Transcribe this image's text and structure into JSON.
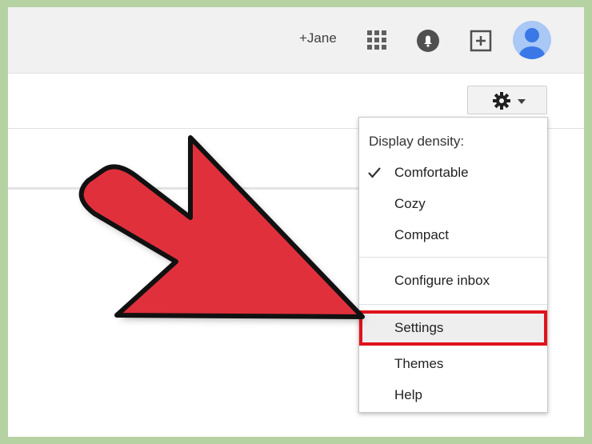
{
  "header": {
    "user_link": "+Jane",
    "icons": [
      "apps-grid-icon",
      "notifications-bell-icon",
      "share-plus-icon",
      "user-avatar-icon"
    ]
  },
  "toolbar": {
    "settings_icon": "gear-icon"
  },
  "menu": {
    "heading": "Display density:",
    "items": [
      {
        "label": "Comfortable",
        "checked": true
      },
      {
        "label": "Cozy",
        "checked": false
      },
      {
        "label": "Compact",
        "checked": false
      },
      {
        "label": "Configure inbox"
      },
      {
        "label": "Settings",
        "highlighted": true
      },
      {
        "label": "Themes"
      },
      {
        "label": "Help"
      }
    ]
  },
  "colors": {
    "highlight_border": "#e0121c",
    "arrow_fill": "#e0303c",
    "avatar_blue": "#4285f4",
    "frame_background": "#b6d2a3"
  }
}
